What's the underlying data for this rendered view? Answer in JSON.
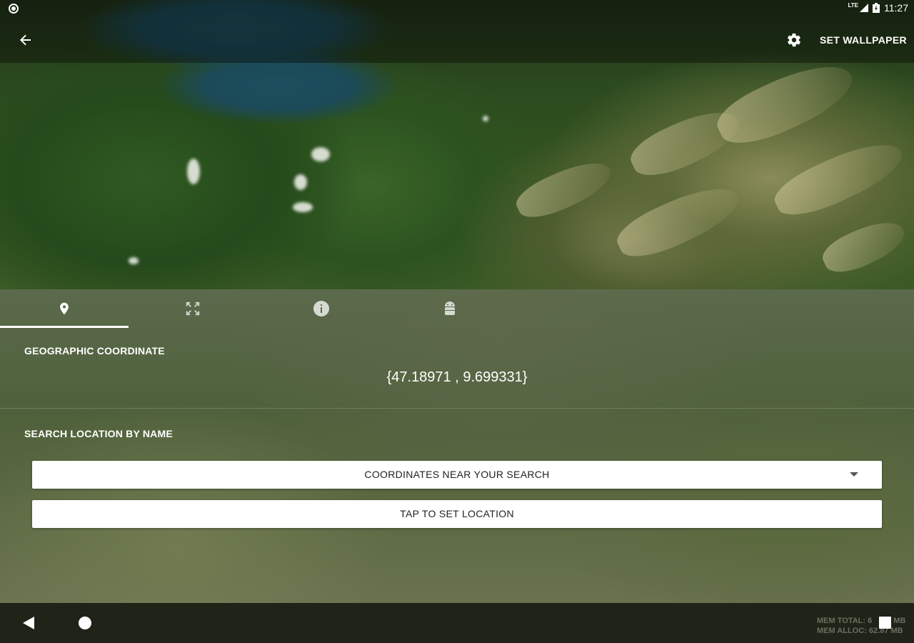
{
  "status_bar": {
    "network_label": "LTE",
    "time": "11:27"
  },
  "toolbar": {
    "back_icon": "arrow-back-icon",
    "settings_icon": "gear-icon",
    "set_wallpaper_label": "SET WALLPAPER"
  },
  "tabs": [
    {
      "icon": "location-pin-icon",
      "selected": true
    },
    {
      "icon": "fullscreen-icon",
      "selected": false
    },
    {
      "icon": "info-icon",
      "selected": false
    },
    {
      "icon": "android-icon",
      "selected": false
    }
  ],
  "coordinate_section": {
    "label": "GEOGRAPHIC COORDINATE",
    "value": "{47.18971 , 9.699331}"
  },
  "search_section": {
    "label": "SEARCH LOCATION BY NAME",
    "dropdown_value": "COORDINATES NEAR YOUR SEARCH",
    "set_location_label": "TAP TO SET LOCATION"
  },
  "nav_bar": {
    "back_icon": "nav-back-icon",
    "home_icon": "nav-home-icon",
    "recents_icon": "nav-recents-icon"
  },
  "debug_overlay": {
    "mem_total": "MEM TOTAL: 6",
    "mem_total_suffix": "MB",
    "mem_alloc": "MEM ALLOC: 62.87 MB"
  },
  "colors": {
    "panel": "#55663f",
    "nav_bar": "#1f2318",
    "text": "#ffffff",
    "button_bg": "#ffffff",
    "button_text": "#222222"
  }
}
